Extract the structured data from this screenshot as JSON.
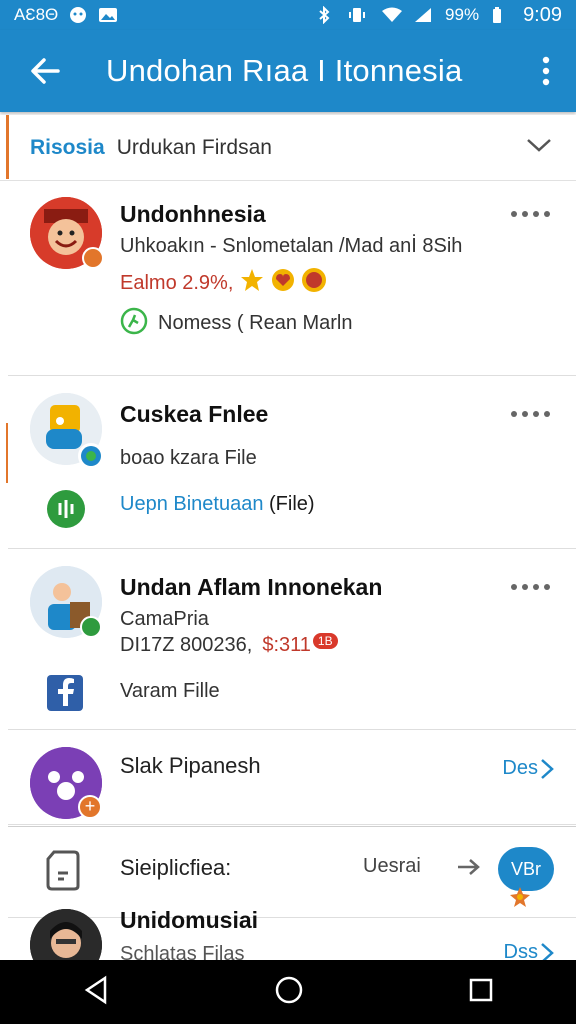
{
  "status_bar": {
    "carrier": "AƐ8Θ",
    "battery": "99%",
    "time": "9:09"
  },
  "app_bar": {
    "title": "Undohan Rıaa I Itonnesia"
  },
  "filter": {
    "label": "Risosia",
    "value": "Urdukan Firdsan"
  },
  "items": [
    {
      "name": "Undonhnesia",
      "line1": "Uhkoakın - Snlometalan /Mad anİ 8Sih",
      "line2": "Ealmo 2.9%,",
      "action_text": "Nomess ( Rean Marln"
    },
    {
      "name": "Cuskea Fnlee",
      "line1": "boao kzara File",
      "action_text": "Uepn Binetuaan",
      "action_suffix": "(File)"
    },
    {
      "name": "Undan Aflam Innonekan",
      "line1": "CamaPria",
      "line2": "DI17Z 800236,",
      "price": "$:311",
      "price_badge": "1B",
      "action_text": "Varam Fille"
    },
    {
      "name": "Slak Pipanesh",
      "action_text": "Des"
    }
  ],
  "row_simplified": {
    "label": "Sieiplicfiea:",
    "value": "Uesrai",
    "bubble": "VBr"
  },
  "row_last": {
    "name": "Unidomusiai",
    "sub": "Schlatas Filas",
    "action_text": "Dss"
  },
  "colors": {
    "primary": "#1e88c9",
    "accent": "#e2762b",
    "green": "#2e9b3e",
    "purple": "#7b3fb5"
  }
}
